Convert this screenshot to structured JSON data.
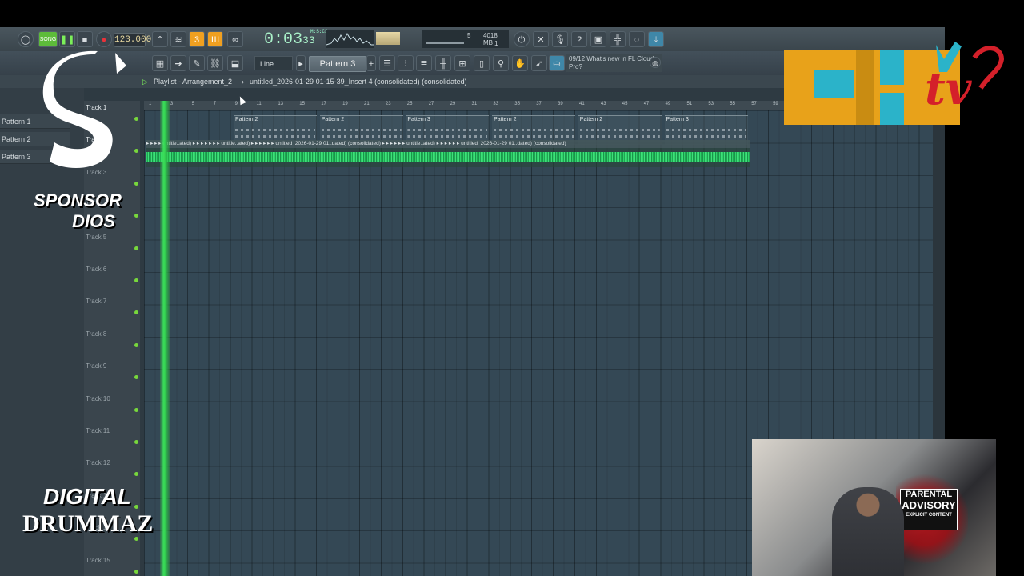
{
  "toolbar": {
    "mode": "SONG",
    "tempo": "123.000",
    "time_main": "0:03",
    "time_sub": "33",
    "time_unit": "M:S:CS",
    "memory_num": "5",
    "memory": "4018 MB",
    "memory_sub": "1",
    "snap": "Line",
    "pattern": "Pattern 3",
    "news": "09/12  What's new in FL Cloud Pro?"
  },
  "playlist": {
    "title": "Playlist - Arrangement_2",
    "path": "untitled_2026-01-29 01-15-39_Insert 4 (consolidated) (consolidated)"
  },
  "patterns": [
    "Pattern 1",
    "Pattern 2",
    "Pattern 3"
  ],
  "tracks": [
    "Track 1",
    "Track 2",
    "Track 3",
    "Track 4",
    "Track 5",
    "Track 6",
    "Track 7",
    "Track 8",
    "Track 9",
    "Track 10",
    "Track 11",
    "Track 12",
    "Track 13",
    "Track 14",
    "Track 15"
  ],
  "ruler_ticks": [
    "1",
    "3",
    "5",
    "7",
    "9",
    "11",
    "13",
    "15",
    "17",
    "19",
    "21",
    "23",
    "25",
    "27",
    "29",
    "31",
    "33",
    "35",
    "37",
    "39",
    "41",
    "43",
    "45",
    "47",
    "49",
    "51",
    "53",
    "55",
    "57",
    "59"
  ],
  "pattern_clips": [
    "Pattern 2",
    "Pattern 2",
    "Pattern 3",
    "Pattern 2",
    "Pattern 2",
    "Pattern 3"
  ],
  "audio_clip_label": "▸ ▸ ▸ ▸ untitle..ated) ▸ ▸ ▸ ▸ ▸ ▸ ▸ untitle..ated) ▸ ▸ ▸ ▸ ▸ ▸ untitled_2026-01-29 01..dated) (consolidated) ▸ ▸ ▸ ▸ ▸ ▸ untitle..ated) ▸ ▸ ▸ ▸ ▸ ▸ untitled_2026-01-29 01..dated) (consolidated)",
  "overlays": {
    "sponsor_line1": "SPONSOR",
    "sponsor_line2": "DIOS",
    "drummaz_line1": "DIGITAL",
    "drummaz_line2": "DRUMMAZ",
    "parental_1": "PARENTAL",
    "parental_2": "ADVISORY",
    "parental_3": "EXPLICIT CONTENT",
    "brand_chtv_letters": "CH",
    "brand_chtv_tv": "tv"
  },
  "colors": {
    "accent_green": "#3be05a",
    "brand_orange": "#e8a21a",
    "brand_teal": "#2bb3c9",
    "brand_red": "#d4202a"
  }
}
